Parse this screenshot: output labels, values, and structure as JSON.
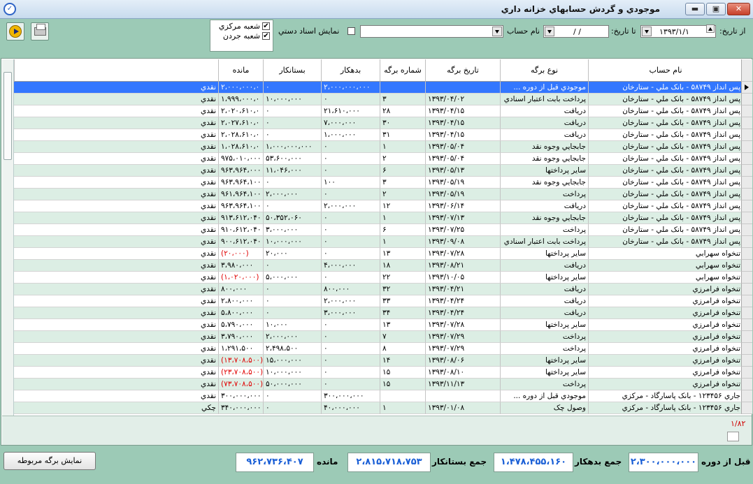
{
  "window": {
    "title": "موجودي و گردش حسابهاي خزانه داري",
    "app_icon_glyph": "✓",
    "minimize_glyph": "▬",
    "maximize_glyph": "▣",
    "close_glyph": "✕"
  },
  "toolbar": {
    "from_date_label": "از تاريخ:",
    "from_date_value": "۱۳۹۳/۱/۱",
    "to_date_label": "تا تاريخ:",
    "to_date_value": "/    /",
    "account_label": "نام حساب",
    "account_value": "",
    "manual_docs_label": "نمايش اسناد دستي",
    "branches": [
      {
        "label": "شعبه مركزي",
        "checked": "✔"
      },
      {
        "label": "شعبه جردن",
        "checked": "✔"
      }
    ],
    "run_icon": "play-icon",
    "print_icon": "printer-icon"
  },
  "grid": {
    "columns": [
      "نام حساب",
      "نوع برگه",
      "تاريخ برگه",
      "شماره برگه",
      "بدهكار",
      "بستانكار",
      "مانده",
      ""
    ],
    "rows": [
      [
        "پس انداز ۵۸۷۴۹ - بانک ملي - ستارخان",
        "موجودي قبل از دوره ...",
        "",
        "",
        "۲،۰۰۰،۰۰۰،۰۰۰",
        "۰",
        "۲،۰۰۰،۰۰۰،۰",
        "نقدي"
      ],
      [
        "پس انداز ۵۸۷۴۹ - بانک ملي - ستارخان",
        "پرداخت بابت اعتبار اسنادي",
        "۱۳۹۳/۰۴/۰۲",
        "۳",
        "۰",
        "۱۰،۰۰۰،۰۰۰",
        "۱،۹۹۹،۰۰۰،۰",
        "نقدي"
      ],
      [
        "پس انداز ۵۸۷۴۹ - بانک ملي - ستارخان",
        "دريافت",
        "۱۳۹۳/۰۴/۱۵",
        "۲۸",
        "۲۱،۶۱۰،۰۰۰",
        "۰",
        "۲،۰۲۰،۶۱۰،۰",
        "نقدي"
      ],
      [
        "پس انداز ۵۸۷۴۹ - بانک ملي - ستارخان",
        "دريافت",
        "۱۳۹۳/۰۴/۱۵",
        "۳۰",
        "۷،۰۰۰،۰۰۰",
        "۰",
        "۲،۰۲۷،۶۱۰،۰",
        "نقدي"
      ],
      [
        "پس انداز ۵۸۷۴۹ - بانک ملي - ستارخان",
        "دريافت",
        "۱۳۹۳/۰۴/۱۵",
        "۳۱",
        "۱،۰۰۰،۰۰۰",
        "۰",
        "۲،۰۲۸،۶۱۰،۰",
        "نقدي"
      ],
      [
        "پس انداز ۵۸۷۴۹ - بانک ملي - ستارخان",
        "جابجايي وجوه نقد",
        "۱۳۹۳/۰۵/۰۴",
        "۱",
        "۰",
        "۱،۰۰۰،۰۰۰،۰۰۰",
        "۱،۰۲۸،۶۱۰،۰",
        "نقدي"
      ],
      [
        "پس انداز ۵۸۷۴۹ - بانک ملي - ستارخان",
        "جابجايي وجوه نقد",
        "۱۳۹۳/۰۵/۰۴",
        "۲",
        "۰",
        "۵۳،۶۰۰،۰۰۰",
        "۹۷۵،۰۱۰،۰۰۰",
        "نقدي"
      ],
      [
        "پس انداز ۵۸۷۴۹ - بانک ملي - ستارخان",
        "ساير پرداختها",
        "۱۳۹۳/۰۵/۱۳",
        "۶",
        "۰",
        "۱۱،۰۴۶،۰۰۰",
        "۹۶۳،۹۶۴،۰۰۰",
        "نقدي"
      ],
      [
        "پس انداز ۵۸۷۴۹ - بانک ملي - ستارخان",
        "جابجايي وجوه نقد",
        "۱۳۹۳/۰۵/۱۹",
        "۳",
        "۱۰۰",
        "۰",
        "۹۶۳،۹۶۴،۱۰۰",
        "نقدي"
      ],
      [
        "پس انداز ۵۸۷۴۹ - بانک ملي - ستارخان",
        "پرداخت",
        "۱۳۹۳/۰۵/۱۹",
        "۲",
        "۰",
        "۲،۰۰۰،۰۰۰",
        "۹۶۱،۹۶۴،۱۰۰",
        "نقدي"
      ],
      [
        "پس انداز ۵۸۷۴۹ - بانک ملي - ستارخان",
        "دريافت",
        "۱۳۹۳/۰۶/۱۴",
        "۱۲",
        "۲،۰۰۰،۰۰۰",
        "۰",
        "۹۶۳،۹۶۴،۱۰۰",
        "نقدي"
      ],
      [
        "پس انداز ۵۸۷۴۹ - بانک ملي - ستارخان",
        "جابجايي وجوه نقد",
        "۱۳۹۳/۰۷/۱۳",
        "۱",
        "۰",
        "۵۰،۳۵۲،۰۶۰",
        "۹۱۳،۶۱۲،۰۴۰",
        "نقدي"
      ],
      [
        "پس انداز ۵۸۷۴۹ - بانک ملي - ستارخان",
        "پرداخت",
        "۱۳۹۳/۰۷/۲۵",
        "۶",
        "۰",
        "۳،۰۰۰،۰۰۰",
        "۹۱۰،۶۱۲،۰۴۰",
        "نقدي"
      ],
      [
        "پس انداز ۵۸۷۴۹ - بانک ملي - ستارخان",
        "پرداخت بابت اعتبار اسنادي",
        "۱۳۹۳/۰۹/۰۸",
        "۱",
        "۰",
        "۱۰،۰۰۰،۰۰۰",
        "۹۰۰،۶۱۲،۰۴۰",
        "نقدي"
      ],
      [
        "تنخواه  سهرابي",
        "ساير پرداختها",
        "۱۳۹۳/۰۷/۲۸",
        "۱۳",
        "۰",
        "۲۰،۰۰۰",
        "(۲۰،۰۰۰)",
        "نقدي"
      ],
      [
        "تنخواه  سهرابي",
        "دريافت",
        "۱۳۹۳/۰۸/۲۱",
        "۱۸",
        "۴،۰۰۰،۰۰۰",
        "۰",
        "۳،۹۸۰،۰۰۰",
        "نقدي"
      ],
      [
        "تنخواه  سهرابي",
        "ساير پرداختها",
        "۱۳۹۳/۱۰/۰۵",
        "۲۲",
        "۰",
        "۵،۰۰۰،۰۰۰",
        "(۱،۰۲۰،۰۰۰)",
        "نقدي"
      ],
      [
        "تنخواه فرامرزي",
        "دريافت",
        "۱۳۹۳/۰۴/۲۱",
        "۳۲",
        "۸۰۰،۰۰۰",
        "۰",
        "۸۰۰،۰۰۰",
        "نقدي"
      ],
      [
        "تنخواه فرامرزي",
        "دريافت",
        "۱۳۹۳/۰۴/۲۴",
        "۳۳",
        "۲،۰۰۰،۰۰۰",
        "۰",
        "۲،۸۰۰،۰۰۰",
        "نقدي"
      ],
      [
        "تنخواه فرامرزي",
        "دريافت",
        "۱۳۹۳/۰۴/۲۴",
        "۳۴",
        "۳،۰۰۰،۰۰۰",
        "۰",
        "۵،۸۰۰،۰۰۰",
        "نقدي"
      ],
      [
        "تنخواه فرامرزي",
        "ساير پرداختها",
        "۱۳۹۳/۰۷/۲۸",
        "۱۳",
        "۰",
        "۱۰،۰۰۰",
        "۵،۷۹۰،۰۰۰",
        "نقدي"
      ],
      [
        "تنخواه فرامرزي",
        "پرداخت",
        "۱۳۹۳/۰۷/۲۹",
        "۷",
        "۰",
        "۲،۰۰۰،۰۰۰",
        "۳،۷۹۰،۰۰۰",
        "نقدي"
      ],
      [
        "تنخواه فرامرزي",
        "پرداخت",
        "۱۳۹۳/۰۷/۲۹",
        "۸",
        "۰",
        "۲،۴۹۸،۵۰۰",
        "۱،۲۹۱،۵۰۰",
        "نقدي"
      ],
      [
        "تنخواه فرامرزي",
        "ساير پرداختها",
        "۱۳۹۳/۰۸/۰۶",
        "۱۴",
        "۰",
        "۱۵،۰۰۰،۰۰۰",
        "(۱۳،۷۰۸،۵۰۰)",
        "نقدي"
      ],
      [
        "تنخواه فرامرزي",
        "ساير پرداختها",
        "۱۳۹۳/۰۸/۱۰",
        "۱۵",
        "۰",
        "۱۰،۰۰۰،۰۰۰",
        "(۲۳،۷۰۸،۵۰۰)",
        "نقدي"
      ],
      [
        "تنخواه فرامرزي",
        "پرداخت",
        "۱۳۹۳/۱۱/۱۳",
        "۱۵",
        "۰",
        "۵۰،۰۰۰،۰۰۰",
        "(۷۳،۷۰۸،۵۰۰)",
        "نقدي"
      ],
      [
        "جاري ۱۲۳۴۵۶ - بانک پاسارگاد - مرکزي",
        "موجودي قبل از دوره ...",
        "",
        "",
        "۳۰۰،۰۰۰،۰۰۰",
        "۰",
        "۳۰۰،۰۰۰،۰۰۰",
        "نقدي"
      ],
      [
        "جاري ۱۲۳۴۵۶ - بانک پاسارگاد - مرکزي",
        "وصول چک",
        "۱۳۹۳/۰۱/۰۸",
        "۱",
        "۴۰،۰۰۰،۰۰۰",
        "۰",
        "۳۴۰،۰۰۰،۰۰۰",
        "چکي"
      ]
    ],
    "page_indicator": "۱/۸۲"
  },
  "summary": {
    "before_period_label": "قبل از دوره",
    "before_period_value": "۲،۳۰۰،۰۰۰،۰۰۰",
    "total_debit_label": "جمع بدهكار",
    "total_debit_value": "۱،۴۷۸،۴۵۵،۱۶۰",
    "total_credit_label": "جمع بستانكار",
    "total_credit_value": "۲،۸۱۵،۷۱۸،۷۵۳",
    "balance_label": "مانده",
    "balance_value": "۹۶۲،۷۳۶،۴۰۷",
    "related_doc_button": "نمايش برگه مربوطه"
  }
}
